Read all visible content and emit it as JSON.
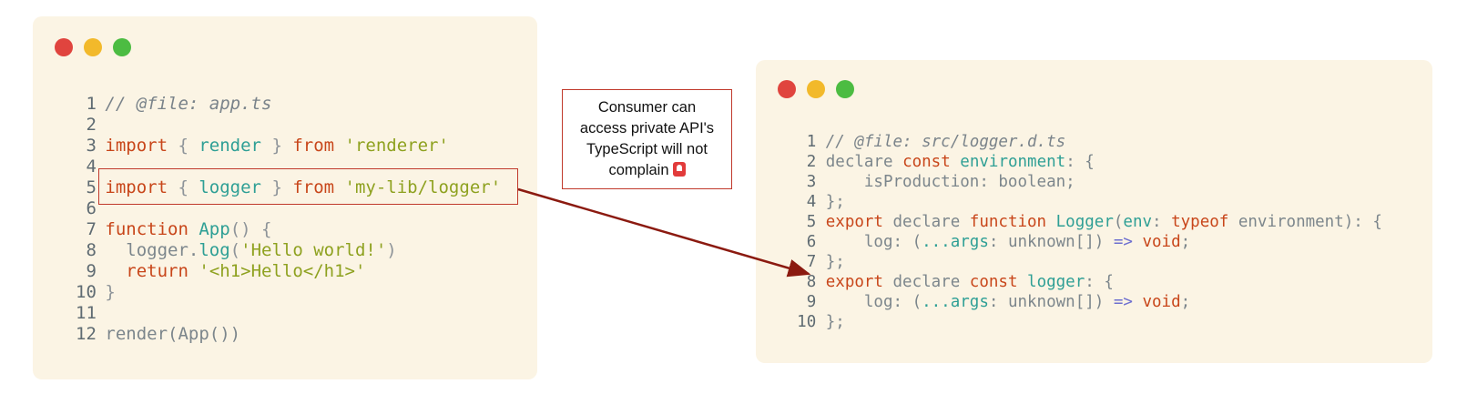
{
  "left_window": {
    "lines": [
      {
        "n": "1",
        "tokens": [
          {
            "t": "// @file: app.ts",
            "c": "comment"
          }
        ]
      },
      {
        "n": "2",
        "tokens": []
      },
      {
        "n": "3",
        "tokens": [
          {
            "t": "import",
            "c": "keyword"
          },
          {
            "t": " { ",
            "c": "punct"
          },
          {
            "t": "render",
            "c": "ident"
          },
          {
            "t": " } ",
            "c": "punct"
          },
          {
            "t": "from",
            "c": "keyword"
          },
          {
            "t": " ",
            "c": "plain"
          },
          {
            "t": "'renderer'",
            "c": "string"
          }
        ]
      },
      {
        "n": "4",
        "tokens": []
      },
      {
        "n": "5",
        "tokens": [
          {
            "t": "import",
            "c": "keyword"
          },
          {
            "t": " { ",
            "c": "punct"
          },
          {
            "t": "logger",
            "c": "ident"
          },
          {
            "t": " } ",
            "c": "punct"
          },
          {
            "t": "from",
            "c": "keyword"
          },
          {
            "t": " ",
            "c": "plain"
          },
          {
            "t": "'my-lib/logger'",
            "c": "string"
          }
        ]
      },
      {
        "n": "6",
        "tokens": []
      },
      {
        "n": "7",
        "tokens": [
          {
            "t": "function",
            "c": "keyword"
          },
          {
            "t": " ",
            "c": "plain"
          },
          {
            "t": "App",
            "c": "ident"
          },
          {
            "t": "() {",
            "c": "punct"
          }
        ]
      },
      {
        "n": "8",
        "tokens": [
          {
            "t": "  logger.",
            "c": "plain"
          },
          {
            "t": "log",
            "c": "ident"
          },
          {
            "t": "(",
            "c": "punct"
          },
          {
            "t": "'Hello world!'",
            "c": "string"
          },
          {
            "t": ")",
            "c": "punct"
          }
        ]
      },
      {
        "n": "9",
        "tokens": [
          {
            "t": "  ",
            "c": "plain"
          },
          {
            "t": "return",
            "c": "keyword"
          },
          {
            "t": " ",
            "c": "plain"
          },
          {
            "t": "'<h1>Hello</h1>'",
            "c": "string"
          }
        ]
      },
      {
        "n": "10",
        "tokens": [
          {
            "t": "}",
            "c": "punct"
          }
        ]
      },
      {
        "n": "11",
        "tokens": []
      },
      {
        "n": "12",
        "tokens": [
          {
            "t": "render(App())",
            "c": "plain"
          }
        ]
      }
    ]
  },
  "right_window": {
    "lines": [
      {
        "n": "1",
        "tokens": [
          {
            "t": "// @file: src/logger.d.ts",
            "c": "comment"
          }
        ]
      },
      {
        "n": "2",
        "tokens": [
          {
            "t": "declare",
            "c": "plain"
          },
          {
            "t": " ",
            "c": "plain"
          },
          {
            "t": "const",
            "c": "keyword"
          },
          {
            "t": " ",
            "c": "plain"
          },
          {
            "t": "environment",
            "c": "ident"
          },
          {
            "t": ": {",
            "c": "plain"
          }
        ]
      },
      {
        "n": "3",
        "tokens": [
          {
            "t": "    isProduction: boolean;",
            "c": "plain"
          }
        ]
      },
      {
        "n": "4",
        "tokens": [
          {
            "t": "};",
            "c": "plain"
          }
        ]
      },
      {
        "n": "5",
        "tokens": [
          {
            "t": "export",
            "c": "keyword"
          },
          {
            "t": " declare ",
            "c": "plain"
          },
          {
            "t": "function",
            "c": "keyword"
          },
          {
            "t": " ",
            "c": "plain"
          },
          {
            "t": "Logger",
            "c": "ident"
          },
          {
            "t": "(",
            "c": "plain"
          },
          {
            "t": "env",
            "c": "ident"
          },
          {
            "t": ": ",
            "c": "plain"
          },
          {
            "t": "typeof",
            "c": "keyword"
          },
          {
            "t": " environment): {",
            "c": "plain"
          }
        ]
      },
      {
        "n": "6",
        "tokens": [
          {
            "t": "    log: (",
            "c": "plain"
          },
          {
            "t": "...args",
            "c": "ident"
          },
          {
            "t": ": unknown[]) ",
            "c": "plain"
          },
          {
            "t": "=>",
            "c": "op"
          },
          {
            "t": " ",
            "c": "plain"
          },
          {
            "t": "void",
            "c": "keyword"
          },
          {
            "t": ";",
            "c": "plain"
          }
        ]
      },
      {
        "n": "7",
        "tokens": [
          {
            "t": "};",
            "c": "plain"
          }
        ]
      },
      {
        "n": "8",
        "tokens": [
          {
            "t": "export",
            "c": "keyword"
          },
          {
            "t": " declare ",
            "c": "plain"
          },
          {
            "t": "const",
            "c": "keyword"
          },
          {
            "t": " ",
            "c": "plain"
          },
          {
            "t": "logger",
            "c": "ident"
          },
          {
            "t": ": {",
            "c": "plain"
          }
        ]
      },
      {
        "n": "9",
        "tokens": [
          {
            "t": "    log: (",
            "c": "plain"
          },
          {
            "t": "...args",
            "c": "ident"
          },
          {
            "t": ": unknown[]) ",
            "c": "plain"
          },
          {
            "t": "=>",
            "c": "op"
          },
          {
            "t": " ",
            "c": "plain"
          },
          {
            "t": "void",
            "c": "keyword"
          },
          {
            "t": ";",
            "c": "plain"
          }
        ]
      },
      {
        "n": "10",
        "tokens": [
          {
            "t": "};",
            "c": "plain"
          }
        ]
      }
    ]
  },
  "callout": {
    "lines": [
      "Consumer can",
      "access private API's",
      "TypeScript will not",
      "complain"
    ],
    "icon": "siren-icon"
  },
  "colors": {
    "window_bg": "#fbf4e4",
    "dot_red": "#e0443e",
    "dot_yellow": "#f2b92b",
    "dot_green": "#4cbc42",
    "keyword": "#c8461a",
    "string": "#8ea11f",
    "identifier": "#2e9f95",
    "comment": "#7a838a",
    "arrow": "#8b1a10",
    "highlight_border": "#c0392b"
  }
}
